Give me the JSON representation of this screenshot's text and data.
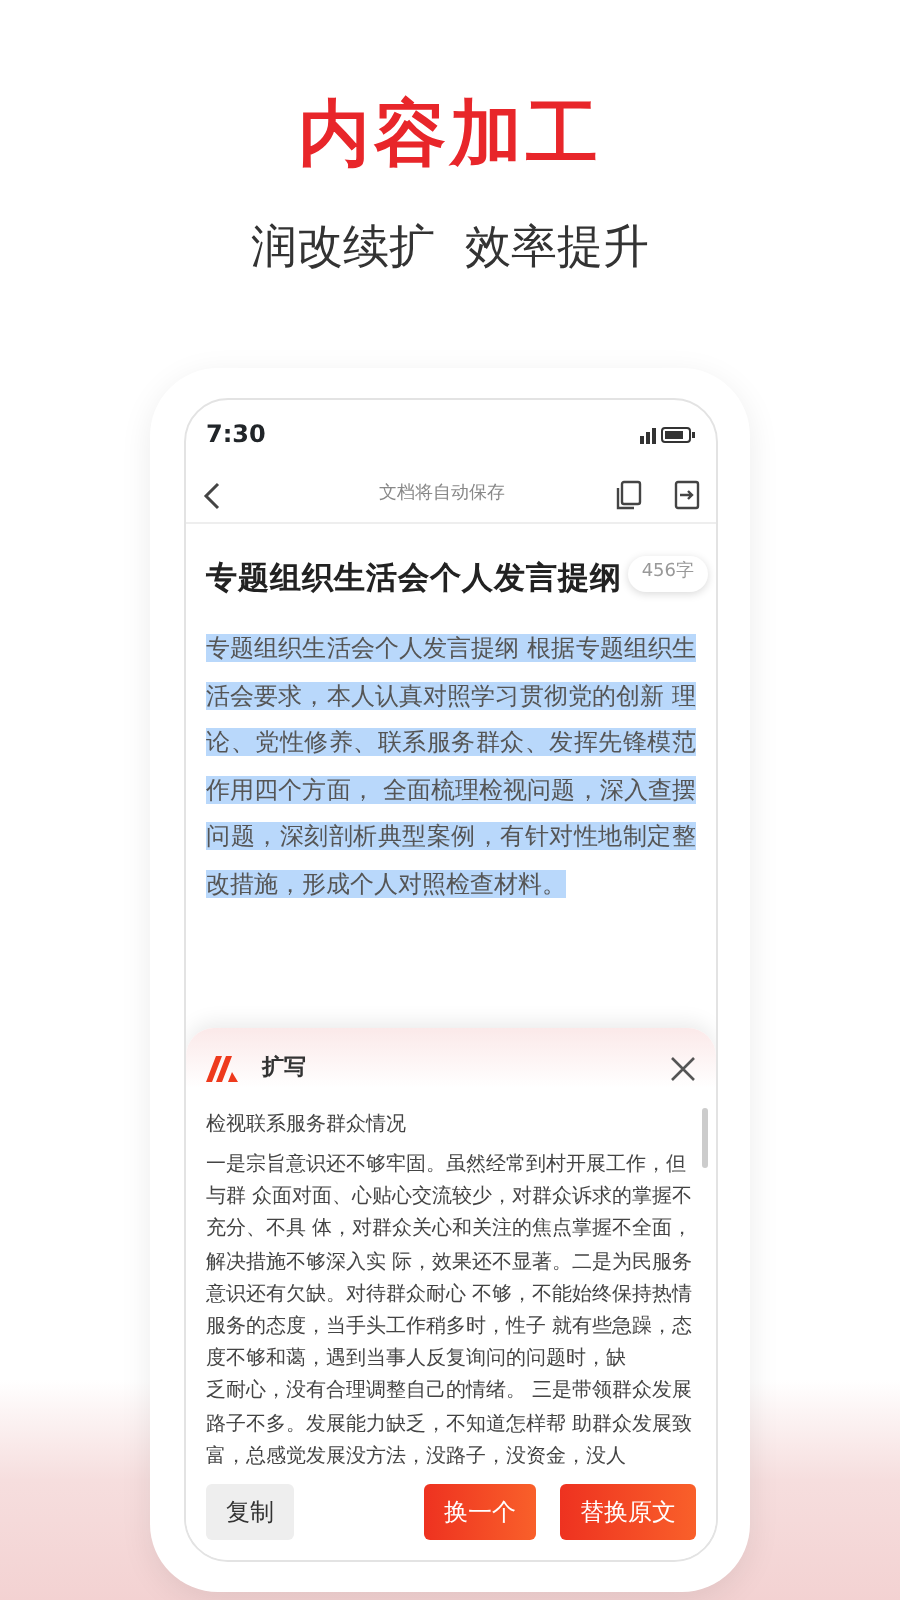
{
  "headline": "内容加工",
  "subheadline": "润改续扩  效率提升",
  "status_bar": {
    "time": "7:30"
  },
  "toolbar": {
    "title": "文档将自动保存"
  },
  "document": {
    "title": "专题组织生活会个人发言提纲",
    "word_count": "456字",
    "body": "专题组织生活会个人发言提纲 根据专题组织生活会要求，本人认真对照学习贯彻党的创新 理论、党性修养、联系服务群众、发挥先锋模范作用四个方面， 全面梳理检视问题，深入查摆问题，深刻剖析典型案例，有针对性地制定整改措施，形成个人对照检查材料。",
    "selected": true
  },
  "panel": {
    "title": "扩写",
    "heading": "检视联系服务群众情况",
    "lines": [
      "一是宗旨意识还不够牢固。虽然经常到村开展工作，但",
      "与群 众面对面、心贴心交流较少，对群众诉求的掌握不",
      "充分、不具 体，对群众关心和关注的焦点掌握不全面，",
      "解决措施不够深入实 际，效果还不显著。二是为民服务",
      "意识还有欠缺。对待群众耐心 不够，不能始终保持热情",
      "服务的态度，当手头工作稍多时，性子 就有些急躁，态",
      "度不够和蔼，遇到当事人反复询问的问题时，缺",
      "乏耐心，没有合理调整自己的情绪。 三是带领群众发展",
      "路子不多。发展能力缺乏，不知道怎样帮 助群众发展致",
      "富，总感觉发展没方法，没路子，没资金，没人"
    ],
    "buttons": [
      {
        "label": "复制",
        "kind": "plain"
      },
      {
        "label": "换一个",
        "kind": "primary"
      },
      {
        "label": "替换原文",
        "kind": "primary"
      }
    ]
  }
}
